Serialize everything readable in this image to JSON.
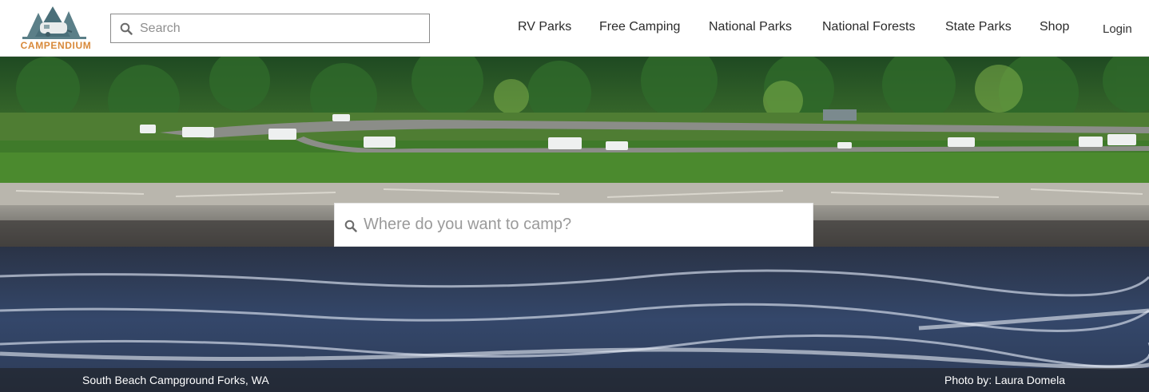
{
  "brand": {
    "name": "CAMPENDIUM",
    "accent_color": "#d8893a",
    "icon": "tent-trailer-logo-icon"
  },
  "header_search": {
    "placeholder": "Search",
    "value": "",
    "icon": "search-icon"
  },
  "nav": {
    "items": [
      {
        "label": "RV Parks"
      },
      {
        "label": "Free Camping"
      },
      {
        "label": "National Parks"
      },
      {
        "label": "National Forests"
      },
      {
        "label": "State Parks"
      },
      {
        "label": "Shop"
      }
    ],
    "login_label": "Login"
  },
  "hero": {
    "search_placeholder": "Where do you want to camp?",
    "search_value": "",
    "search_icon": "search-icon",
    "caption_location": "South Beach Campground Forks, WA",
    "caption_credit": "Photo by: Laura Domela"
  }
}
